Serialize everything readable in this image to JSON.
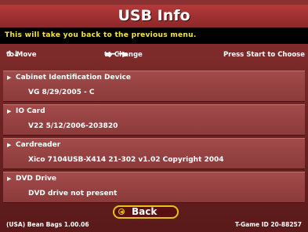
{
  "screen": {
    "title": "USB Info",
    "message": "This will take you back to the previous menu."
  },
  "controls": {
    "move_icon": "up-down-arrows-icon",
    "move_label": "to Move",
    "change_icon": "left-right-arrows-icon",
    "change_label": "to Change",
    "start_label": "Press Start to Choose"
  },
  "items": [
    {
      "label": "Cabinet Identification Device",
      "value": "VG 8/29/2005 - C"
    },
    {
      "label": "IO Card",
      "value": "V22 5/12/2006-203820"
    },
    {
      "label": "Cardreader",
      "value": "Xico 7104USB-X414 21-302 v1.02 Copyright 2004"
    },
    {
      "label": "DVD Drive",
      "value": "DVD drive not present"
    }
  ],
  "back_button": {
    "label": "Back"
  },
  "footer": {
    "left": "(USA) Bean Bags 1.00.06",
    "right": "T-Game ID 20-88257"
  },
  "colors": {
    "title_bar": "#b43a3a",
    "message_text": "#f2e64a",
    "panel": "#a24b4b",
    "button_border": "#e8c21c"
  }
}
